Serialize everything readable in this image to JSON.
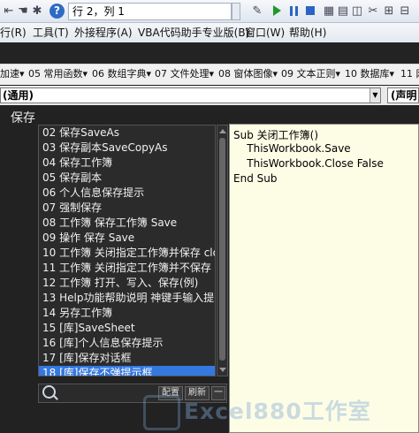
{
  "toolbar": {
    "position_text": "行 2，列 1"
  },
  "menu": [
    "行(R)",
    "工具(T)",
    "外接程序(A)",
    "VBA代码助手专业版(B)",
    "窗口(W)",
    "帮助(H)"
  ],
  "modules": [
    "加速▾",
    "05 常用函数▾",
    "06 数组字典▾",
    "07 文件处理▾",
    "08 窗体图像▾",
    "09 文本正则▾",
    "10 数据库▾",
    "11 网"
  ],
  "combo": {
    "left": "(通用)",
    "right": "(声明"
  },
  "pane_title": "保存",
  "snippets": [
    "02 保存SaveAs",
    "03 保存副本SaveCopyAs",
    "04 保存工作簿",
    "05 保存副本",
    "06 个人信息保存提示",
    "07 强制保存",
    "08 工作簿 保存工作簿 Save",
    "09 操作 保存 Save",
    "10 工作簿 关闭指定工作簿并保存 close",
    "11 工作簿 关闭指定工作簿并不保存 clo",
    "12 工作簿 打开、写入、保存(例)",
    "13 Help功能帮助说明 神键手输入提示",
    "14 另存工作簿",
    "15 [库]SaveSheet",
    "16 [库]个人信息保存提示",
    "17 [库]保存对话框",
    "18 [库]保存不弹提示框"
  ],
  "selected_index": 16,
  "search": {
    "value": "",
    "buttons": [
      "配置",
      "刷新",
      "一"
    ]
  },
  "code": [
    "Sub 关闭工作簿()",
    "    ThisWorkbook.Save",
    "    ThisWorkbook.Close False",
    "End Sub"
  ],
  "watermark": "Excel880工作室"
}
